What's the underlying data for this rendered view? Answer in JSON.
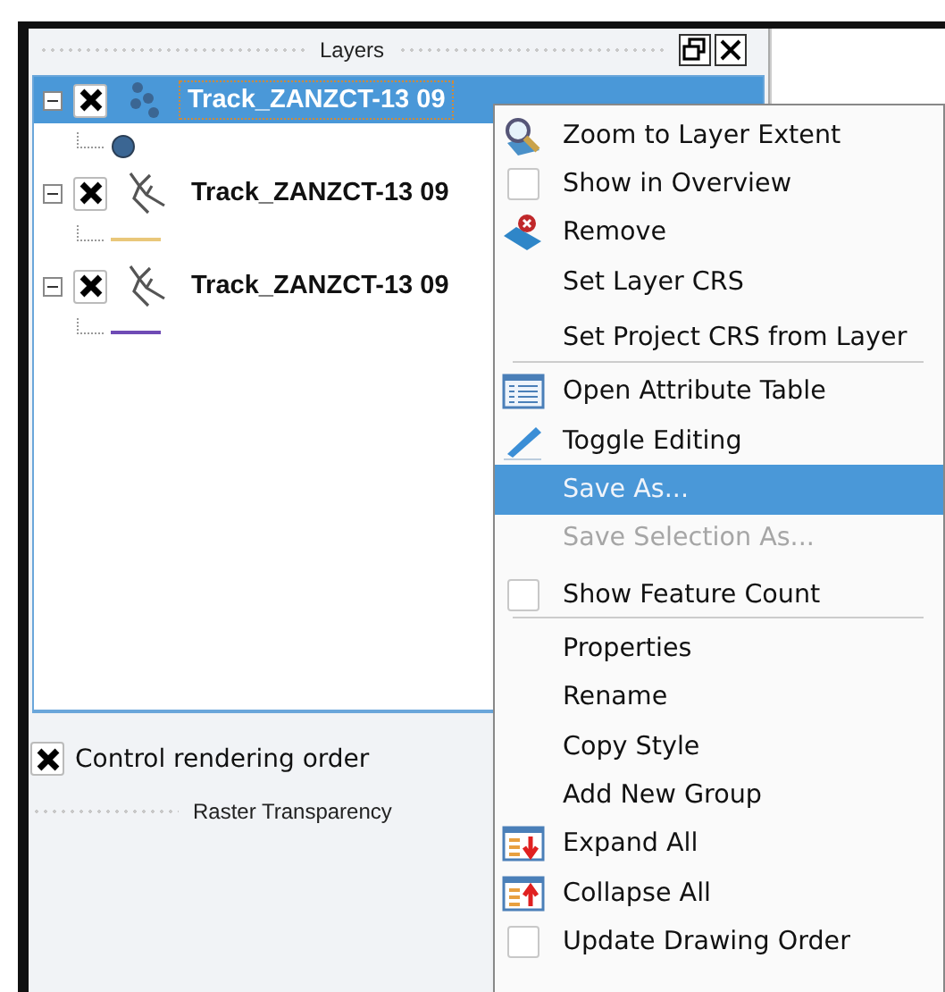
{
  "panel": {
    "title": "Layers"
  },
  "layers": [
    {
      "name": "Track_ZANZCT-13 09",
      "kind": "points",
      "selected": true,
      "expanded": true,
      "checked": true,
      "legend": {
        "kind": "point",
        "color": "#3b6693"
      }
    },
    {
      "name": "Track_ZANZCT-13 09",
      "kind": "lines",
      "selected": false,
      "expanded": true,
      "checked": true,
      "legend": {
        "kind": "line",
        "color": "#e9c77a"
      }
    },
    {
      "name": "Track_ZANZCT-13 09",
      "kind": "lines",
      "selected": false,
      "expanded": true,
      "checked": true,
      "legend": {
        "kind": "line",
        "color": "#6f4bb5"
      }
    }
  ],
  "render_order": {
    "label": "Control rendering order",
    "checked": true
  },
  "next_panel": {
    "title": "Raster Transparency"
  },
  "context_menu": [
    {
      "label": "Zoom to Layer Extent",
      "kind": "zoom",
      "selected": false,
      "disabled": false,
      "separator_after": false
    },
    {
      "label": "Show in Overview",
      "kind": "check",
      "checked": false,
      "selected": false,
      "disabled": false,
      "separator_after": false
    },
    {
      "label": "Remove",
      "kind": "remove",
      "selected": false,
      "disabled": false,
      "separator_after": false
    },
    {
      "label": "Set Layer CRS",
      "kind": "plain",
      "selected": false,
      "disabled": false,
      "separator_after": false
    },
    {
      "label": "Set Project CRS from Layer",
      "kind": "plain",
      "selected": false,
      "disabled": false,
      "separator_after": true
    },
    {
      "label": "Open Attribute Table",
      "kind": "table",
      "selected": false,
      "disabled": false,
      "separator_after": false
    },
    {
      "label": "Toggle Editing",
      "kind": "edit",
      "selected": false,
      "disabled": false,
      "separator_after": false
    },
    {
      "label": "Save As...",
      "kind": "plain",
      "selected": true,
      "disabled": false,
      "separator_after": false
    },
    {
      "label": "Save Selection As...",
      "kind": "plain",
      "selected": false,
      "disabled": true,
      "separator_after": false
    },
    {
      "label": "Show Feature Count",
      "kind": "check",
      "checked": false,
      "selected": false,
      "disabled": false,
      "separator_after": true
    },
    {
      "label": "Properties",
      "kind": "plain",
      "selected": false,
      "disabled": false,
      "separator_after": false
    },
    {
      "label": "Rename",
      "kind": "plain",
      "selected": false,
      "disabled": false,
      "separator_after": false
    },
    {
      "label": "Copy Style",
      "kind": "plain",
      "selected": false,
      "disabled": false,
      "separator_after": false
    },
    {
      "label": "Add New Group",
      "kind": "plain",
      "selected": false,
      "disabled": false,
      "separator_after": false
    },
    {
      "label": "Expand All",
      "kind": "expand",
      "selected": false,
      "disabled": false,
      "separator_after": false
    },
    {
      "label": "Collapse All",
      "kind": "collapse",
      "selected": false,
      "disabled": false,
      "separator_after": false
    },
    {
      "label": "Update Drawing Order",
      "kind": "check",
      "checked": false,
      "selected": false,
      "disabled": false,
      "separator_after": false
    }
  ]
}
